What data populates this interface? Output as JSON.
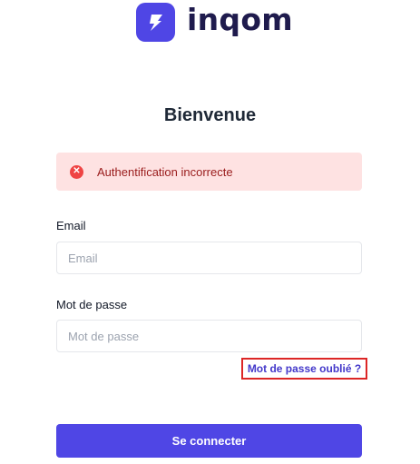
{
  "brand": {
    "name": "inqom",
    "color": "#4f46e5",
    "logo_icon": "lightning-bolt-icon"
  },
  "page": {
    "title": "Bienvenue"
  },
  "alert": {
    "icon": "error-x-icon",
    "message": "Authentification incorrecte",
    "type": "error"
  },
  "form": {
    "email": {
      "label": "Email",
      "placeholder": "Email",
      "value": ""
    },
    "password": {
      "label": "Mot de passe",
      "placeholder": "Mot de passe",
      "value": ""
    },
    "forgot_password_label": "Mot de passe oublié ?",
    "submit_label": "Se connecter"
  }
}
